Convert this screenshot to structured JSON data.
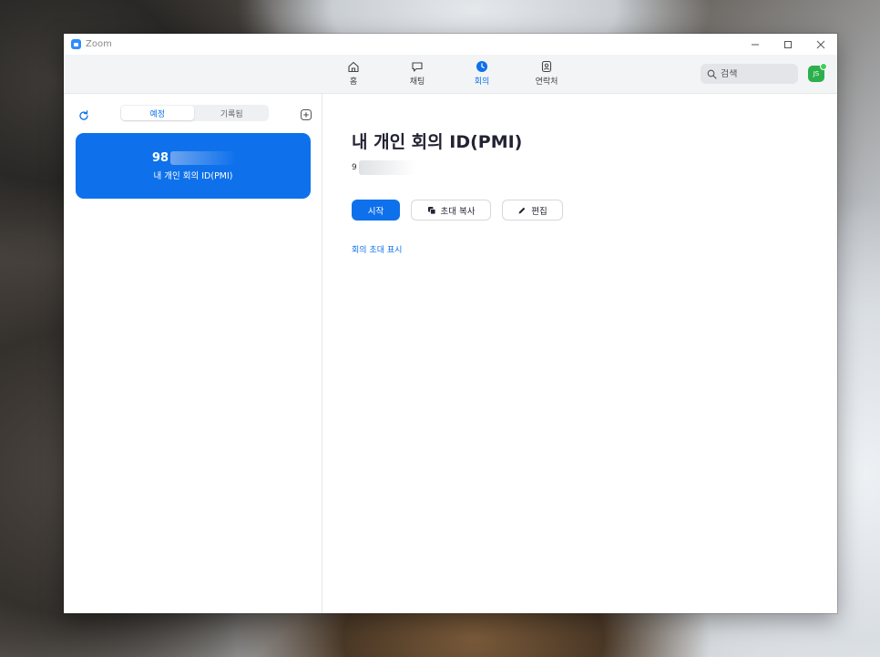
{
  "window": {
    "title": "Zoom"
  },
  "nav": {
    "items": [
      {
        "label": "홈",
        "icon": "home-icon",
        "active": false
      },
      {
        "label": "채팅",
        "icon": "chat-icon",
        "active": false
      },
      {
        "label": "회의",
        "icon": "clock-icon",
        "active": true
      },
      {
        "label": "연락처",
        "icon": "contacts-icon",
        "active": false
      }
    ],
    "search_placeholder": "검색",
    "avatar_initials": "JS",
    "avatar_color": "#2eaf4e",
    "presence_color": "#3fd05a"
  },
  "left": {
    "tabs": [
      {
        "label": "예정",
        "active": true
      },
      {
        "label": "기록됨",
        "active": false
      }
    ],
    "meeting_card": {
      "id_prefix": "98",
      "name": "내 개인 회의 ID(PMI)"
    }
  },
  "right": {
    "title": "내 개인 회의 ID(PMI)",
    "id_prefix": "9",
    "buttons": {
      "start": "시작",
      "copy_invite": "초대 복사",
      "edit": "편집"
    },
    "show_invite_link": "회의 초대 표시"
  },
  "colors": {
    "accent": "#0e71eb",
    "logo": "#2d8cff"
  }
}
